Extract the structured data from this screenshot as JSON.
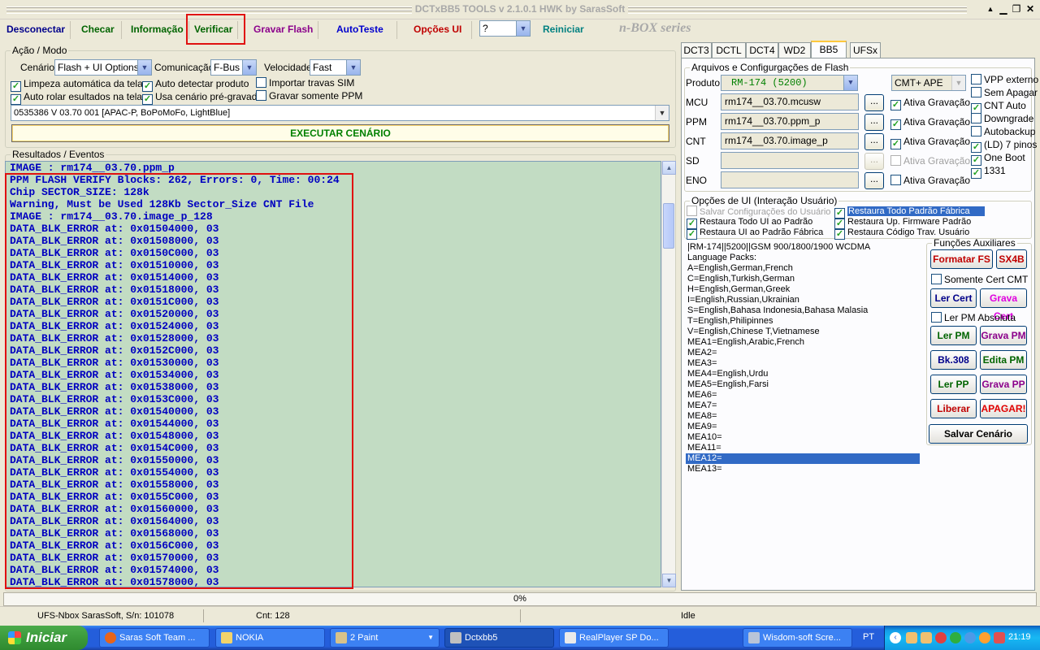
{
  "window": {
    "title": "DCTxBB5 TOOLS v 2.1.0.1 HWK by SarasSoft",
    "min": "▁",
    "restore": "❐",
    "close": "✕",
    "help": "▲"
  },
  "toolbar": {
    "desconectar": "Desconectar",
    "checar": "Checar",
    "informacao": "Informação",
    "verificar": "Verificar",
    "gravar_flash": "Gravar Flash",
    "autoteste": "AutoTeste",
    "opcoes_ui": "Opções UI",
    "help_select": "?",
    "reiniciar": "Reiniciar",
    "brand": "n-BOX series"
  },
  "acao": {
    "legend": "Ação / Modo",
    "cenario_label": "Cenário",
    "cenario_value": "Flash + UI Options",
    "comunicacao_label": "Comunicação",
    "comunicacao_value": "F-Bus",
    "velocidade_label": "Velocidade",
    "velocidade_value": "Fast",
    "checks": {
      "limpeza": "Limpeza automática da tela",
      "auto_detectar": "Auto detectar produto",
      "importar": "Importar travas SIM",
      "auto_rolar": "Auto rolar esultados na tela",
      "usa_cenario": "Usa cenário pré-gravado",
      "gravar_ppm": "Gravar somente PPM"
    },
    "firmware": "0535386 V 03.70 001  [APAC-P, BoPoMoFo, LightBlue]",
    "executar": "EXECUTAR CENÁRIO"
  },
  "resultados": {
    "legend": "Resultados / Eventos",
    "lines": [
      "IMAGE : rm174__03.70.ppm_p",
      "PPM FLASH VERIFY Blocks: 262, Errors: 0, Time: 00:24",
      "Chip SECTOR_SIZE: 128k",
      "Warning, Must be Used 128Kb Sector_Size CNT File",
      "IMAGE : rm174__03.70.image_p_128",
      "DATA_BLK_ERROR at: 0x01504000, 03",
      "DATA_BLK_ERROR at: 0x01508000, 03",
      "DATA_BLK_ERROR at: 0x0150C000, 03",
      "DATA_BLK_ERROR at: 0x01510000, 03",
      "DATA_BLK_ERROR at: 0x01514000, 03",
      "DATA_BLK_ERROR at: 0x01518000, 03",
      "DATA_BLK_ERROR at: 0x0151C000, 03",
      "DATA_BLK_ERROR at: 0x01520000, 03",
      "DATA_BLK_ERROR at: 0x01524000, 03",
      "DATA_BLK_ERROR at: 0x01528000, 03",
      "DATA_BLK_ERROR at: 0x0152C000, 03",
      "DATA_BLK_ERROR at: 0x01530000, 03",
      "DATA_BLK_ERROR at: 0x01534000, 03",
      "DATA_BLK_ERROR at: 0x01538000, 03",
      "DATA_BLK_ERROR at: 0x0153C000, 03",
      "DATA_BLK_ERROR at: 0x01540000, 03",
      "DATA_BLK_ERROR at: 0x01544000, 03",
      "DATA_BLK_ERROR at: 0x01548000, 03",
      "DATA_BLK_ERROR at: 0x0154C000, 03",
      "DATA_BLK_ERROR at: 0x01550000, 03",
      "DATA_BLK_ERROR at: 0x01554000, 03",
      "DATA_BLK_ERROR at: 0x01558000, 03",
      "DATA_BLK_ERROR at: 0x0155C000, 03",
      "DATA_BLK_ERROR at: 0x01560000, 03",
      "DATA_BLK_ERROR at: 0x01564000, 03",
      "DATA_BLK_ERROR at: 0x01568000, 03",
      "DATA_BLK_ERROR at: 0x0156C000, 03",
      "DATA_BLK_ERROR at: 0x01570000, 03",
      "DATA_BLK_ERROR at: 0x01574000, 03",
      "DATA_BLK_ERROR at: 0x01578000, 03"
    ]
  },
  "tabs": [
    "DCT3",
    "DCTL",
    "DCT4",
    "WD2",
    "BB5",
    "UFSx"
  ],
  "arquivos": {
    "legend": "Arquivos e Configurgações de Flash",
    "produto_label": "Produto",
    "produto_value": "RM-174  (5200)",
    "cmt_value": "CMT+ APE",
    "mcu_label": "MCU",
    "mcu_value": "rm174__03.70.mcusw",
    "ppm_label": "PPM",
    "ppm_value": "rm174__03.70.ppm_p",
    "cnt_label": "CNT",
    "cnt_value": "rm174__03.70.image_p",
    "sd_label": "SD",
    "eno_label": "ENO",
    "dots": "...",
    "ativa": "Ativa Gravação",
    "right_checks": [
      "VPP externo",
      "Sem Apagar",
      "CNT Auto",
      "Downgrade",
      "Autobackup",
      "(LD) 7 pinos",
      "One Boot",
      "1331"
    ]
  },
  "opcoes": {
    "legend": "Opções de UI (Interação Usuário)",
    "salvar": "Salvar Configurações do Usuário",
    "restaura_fabrica_todo": "Restaura Todo Padrão Fábrica",
    "restaura_ui": "Restaura Todo UI ao Padrão",
    "restaura_firmware": "Restaura Up. Firmware Padrão",
    "restaura_ui_fabrica": "Restaura UI ao Padrão Fábrica",
    "restaura_codigo": "Restaura Código Trav. Usuário"
  },
  "info_lines": [
    "|RM-174||5200||GSM 900/1800/1900   WCDMA",
    "Language Packs:",
    "A=English,German,French",
    "C=English,Turkish,German",
    "H=English,German,Greek",
    "I=English,Russian,Ukrainian",
    "S=English,Bahasa Indonesia,Bahasa Malasia",
    "T=English,Philipinnes",
    "V=English,Chinese T,Vietnamese",
    "MEA1=English,Arabic,French",
    "MEA2=",
    "MEA3=",
    "MEA4=English,Urdu",
    "MEA5=English,Farsi",
    "MEA6=",
    "MEA7=",
    "MEA8=",
    "MEA9=",
    "MEA10=",
    "MEA11=",
    "MEA12=",
    "MEA13="
  ],
  "funcoes": {
    "legend": "Funções Auxiliares",
    "formatar": "Formatar FS",
    "sx4b": "SX4B",
    "somente_cert": "Somente Cert CMT",
    "ler_cert": "Ler Cert",
    "grava_cert": "Grava Cert",
    "ler_pm_abs": "Ler PM Absoluta",
    "ler_pm": "Ler PM",
    "grava_pm": "Grava PM",
    "bk308": "Bk.308",
    "edita_pm": "Edita PM",
    "ler_pp": "Ler PP",
    "grava_pp": "Grava PP",
    "liberar": "Liberar",
    "apagar": "APAGAR!",
    "salvar_cenario": "Salvar Cenário"
  },
  "progress": "0%",
  "status": {
    "left": "UFS-Nbox SarasSoft, S/n: 101078",
    "cnt": "Cnt: 128",
    "state": "Idle"
  },
  "taskbar": {
    "start": "Iniciar",
    "tasks": [
      "Saras Soft Team ...",
      "NOKIA",
      "2 Paint",
      "Dctxbb5",
      "RealPlayer SP Do...",
      "Wisdom-soft Scre..."
    ],
    "lang": "PT",
    "clock": "21:19"
  }
}
